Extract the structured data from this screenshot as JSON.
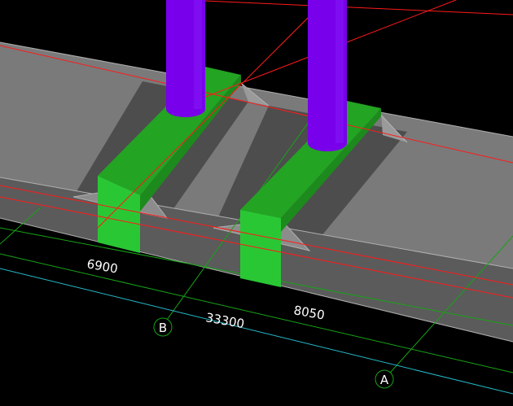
{
  "viewport": {
    "background": "#000000"
  },
  "colors": {
    "slab_top": "#777777",
    "slab_dark": "#4a4a4a",
    "slab_face": "#5e5e5e",
    "slab_edge": "#a8a8a8",
    "footing_top": "#22bb22",
    "footing_side": "#1a8f1a",
    "footing_front": "#22cc33",
    "column": "#7a00ee",
    "column_shade": "#5a00b8",
    "grid_red": "#ff1a1a",
    "grid_green": "#17a317",
    "grid_cyan": "#25b9c9"
  },
  "dimensions": {
    "d1": "6900",
    "d2": "33300",
    "d3": "8050"
  },
  "grid_axes": {
    "b": "B",
    "a": "A"
  }
}
